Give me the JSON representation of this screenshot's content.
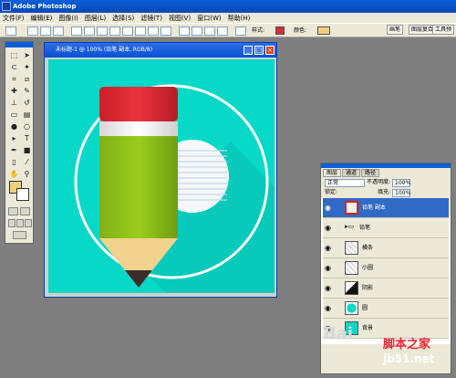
{
  "app": {
    "title": "Adobe Photoshop"
  },
  "menu": [
    "文件(F)",
    "编辑(E)",
    "图像(I)",
    "图层(L)",
    "选择(S)",
    "滤镜(T)",
    "视图(V)",
    "窗口(W)",
    "帮助(H)"
  ],
  "options": {
    "style_label": "样式:",
    "color_label": "颜色:",
    "style_color": "#d62c3b",
    "fill_color": "#f3cd7c"
  },
  "panel_tabs": [
    "画笔",
    "图层复合",
    "工具预"
  ],
  "document": {
    "title": "未标题-1 @ 100% (铅笔 副本, RGB/8)",
    "canvas_color": "#08d8c8"
  },
  "toolbox": {
    "foreground": "#f3cd7c",
    "background": "#ffffff"
  },
  "layers_panel": {
    "tabs": [
      "图层",
      "通道",
      "路径"
    ],
    "blend_mode": "正常",
    "opacity_label": "不透明度:",
    "opacity": "100%",
    "lock_label": "锁定:",
    "fill_label": "填充:",
    "fill": "100%",
    "layers": [
      {
        "name": "铅笔 副本",
        "selected": true
      },
      {
        "name": "铅笔",
        "group": true
      },
      {
        "name": "横条"
      },
      {
        "name": "小圆"
      },
      {
        "name": "阴影"
      },
      {
        "name": "圆"
      },
      {
        "name": "背景"
      }
    ]
  },
  "watermark": {
    "brand": "Bai",
    "cn": "脚本之家",
    "url": "jb51.net"
  }
}
